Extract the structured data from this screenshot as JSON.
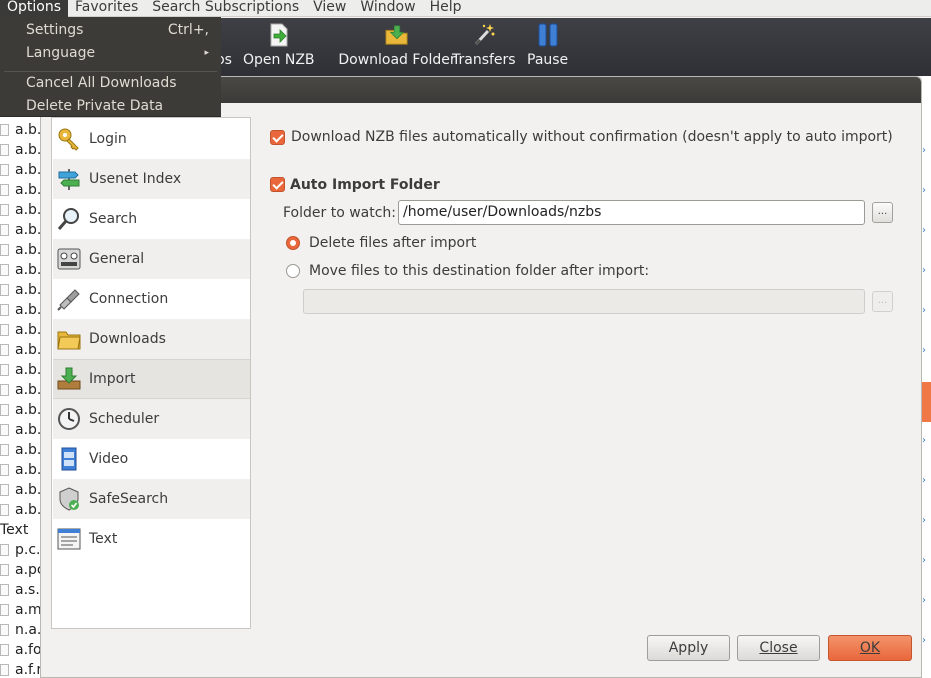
{
  "menubar": {
    "items": [
      "Options",
      "Favorites",
      "Search Subscriptions",
      "View",
      "Window",
      "Help"
    ]
  },
  "options_menu": {
    "items": [
      {
        "label": "Settings",
        "shortcut": "Ctrl+,"
      },
      {
        "label": "Language",
        "submenu_arrow": "▸"
      },
      {
        "label": "Cancel All Downloads"
      },
      {
        "label": "Delete Private Data"
      }
    ]
  },
  "toolbar": {
    "partial_label": "os",
    "buttons": [
      {
        "label": "Open NZB",
        "icon": "open-nzb-icon"
      },
      {
        "label": "Download Folder",
        "icon": "download-folder-icon"
      },
      {
        "label": "Transfers",
        "icon": "magic-wand-icon"
      },
      {
        "label": "Pause",
        "icon": "pause-icon"
      }
    ]
  },
  "background_list": {
    "rows": [
      "a.b.",
      "a.b.",
      "a.b.",
      "a.b.",
      "a.b.",
      "a.b.",
      "a.b.",
      "a.b.",
      "a.b.",
      "a.b.",
      "a.b.",
      "a.b.",
      "a.b.",
      "a.b.",
      "a.b.",
      "a.b.",
      "a.b.",
      "a.b.",
      "a.b.",
      "a.b."
    ],
    "category": "Text",
    "rows2": [
      "p.c.",
      "a.pc",
      "a.s.",
      "a.m",
      "n.a.",
      "a.fo",
      "a.f.rush-limbaugh"
    ]
  },
  "prefs_nav": {
    "items": [
      {
        "label": "Login",
        "icon": "key-icon"
      },
      {
        "label": "Usenet Index",
        "icon": "signpost-icon"
      },
      {
        "label": "Search",
        "icon": "magnifier-icon"
      },
      {
        "label": "General",
        "icon": "control-panel-icon"
      },
      {
        "label": "Connection",
        "icon": "network-cable-icon"
      },
      {
        "label": "Downloads",
        "icon": "folder-icon"
      },
      {
        "label": "Import",
        "icon": "import-tray-icon"
      },
      {
        "label": "Scheduler",
        "icon": "clock-icon"
      },
      {
        "label": "Video",
        "icon": "film-icon"
      },
      {
        "label": "SafeSearch",
        "icon": "shield-check-icon"
      },
      {
        "label": "Text",
        "icon": "text-document-icon"
      }
    ],
    "selected": "Import"
  },
  "import_settings": {
    "auto_download_label": "Download NZB files automatically without confirmation (doesn't apply to auto import)",
    "auto_download_checked": true,
    "auto_import_label": "Auto Import Folder",
    "auto_import_checked": true,
    "folder_label": "Folder to watch:",
    "folder_value": "/home/user/Downloads/nzbs",
    "browse_label": "...",
    "delete_option": "Delete files after import",
    "move_option": "Move files to this destination folder after import:",
    "selected_option": "delete",
    "destination_value": "",
    "dest_browse_label": "..."
  },
  "dialog_buttons": {
    "apply": "Apply",
    "close": "Close",
    "ok": "OK"
  },
  "colors": {
    "accent": "#e9673b",
    "toolbar": "#35363b",
    "menu_bg": "#3c3b37"
  }
}
